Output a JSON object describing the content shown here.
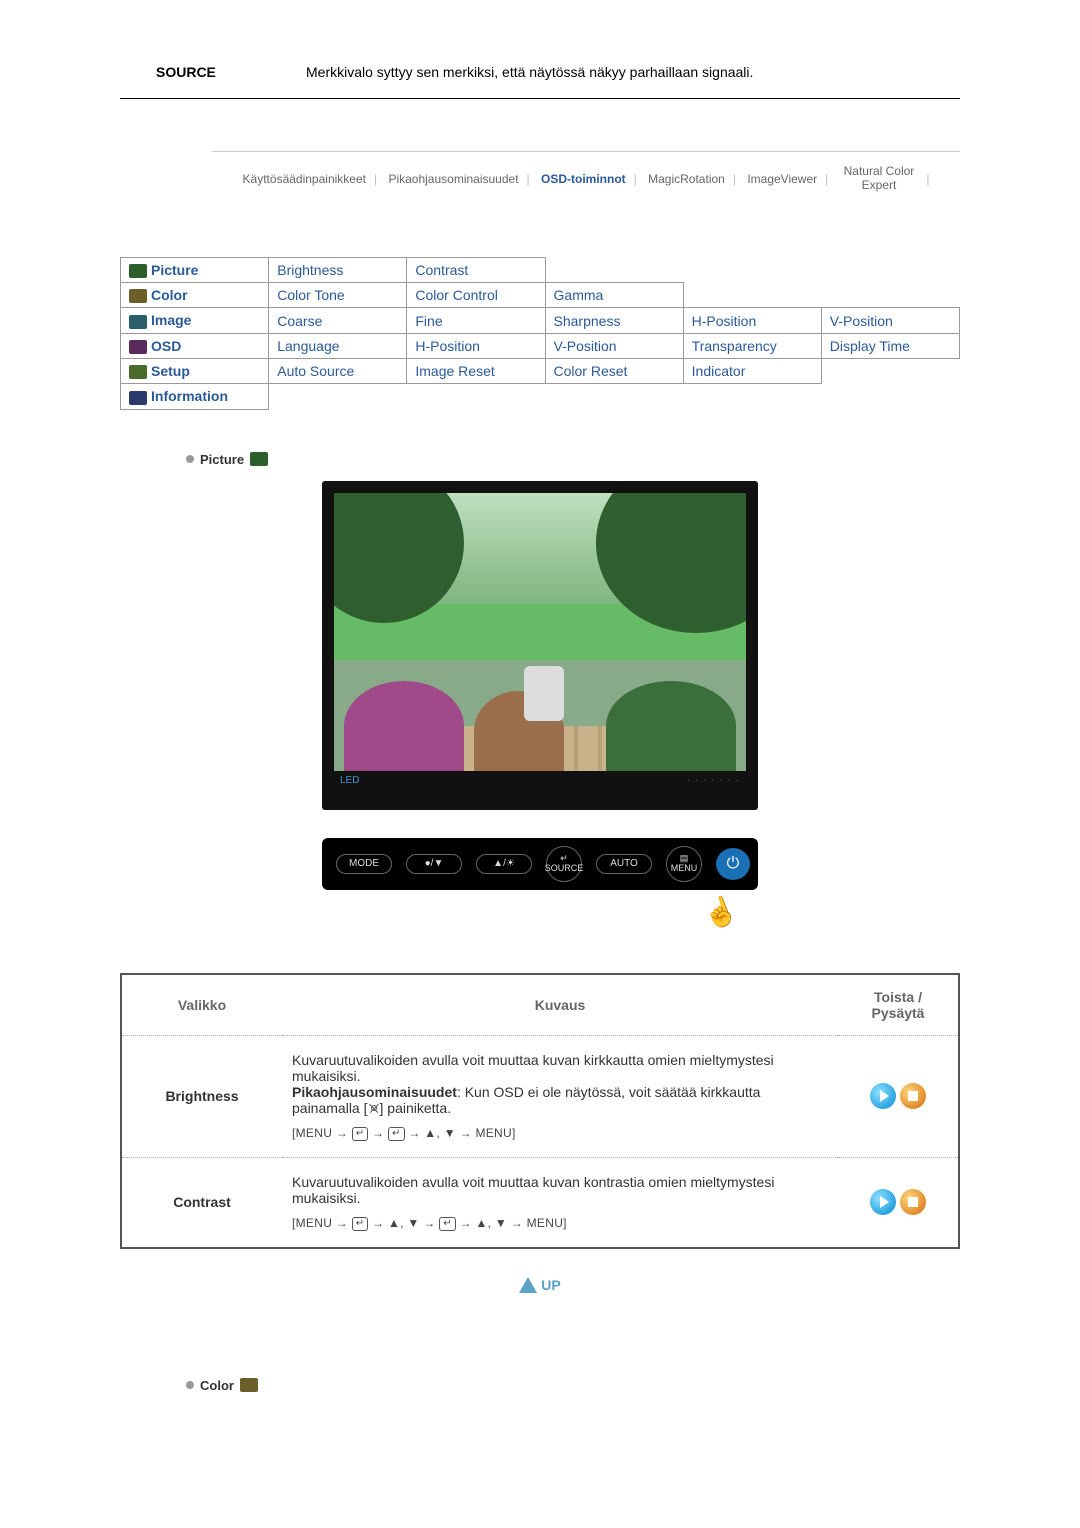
{
  "source_row": {
    "label": "SOURCE",
    "text": "Merkkivalo syttyy sen merkiksi, että näytössä näkyy parhaillaan signaali."
  },
  "tabs": {
    "t0": "Käyttösäädinpainikkeet",
    "t1": "Pikaohjausominaisuudet",
    "t2": "OSD-toiminnot",
    "t3": "MagicRotation",
    "t4": "ImageViewer",
    "t5a": "Natural Color",
    "t5b": "Expert"
  },
  "menu": {
    "picture": "Picture",
    "brightness": "Brightness",
    "contrast": "Contrast",
    "color": "Color",
    "colortone": "Color Tone",
    "colorcontrol": "Color Control",
    "gamma": "Gamma",
    "image": "Image",
    "coarse": "Coarse",
    "fine": "Fine",
    "sharpness": "Sharpness",
    "hpos": "H-Position",
    "vpos": "V-Position",
    "osd": "OSD",
    "language": "Language",
    "transparency": "Transparency",
    "displaytime": "Display Time",
    "setup": "Setup",
    "autosource": "Auto Source",
    "imagereset": "Image Reset",
    "colorreset": "Color Reset",
    "indicator": "Indicator",
    "information": "Information"
  },
  "section": {
    "picture_title": "Picture",
    "color_title": "Color"
  },
  "monitor": {
    "led": "LED",
    "buttons": {
      "mode": "MODE",
      "downup": "●/▼",
      "bright": "▲/☀",
      "source_top": "↵",
      "source": "SOURCE",
      "auto": "AUTO",
      "menu_top": "▤",
      "menu": "MENU",
      "power": "⏻"
    }
  },
  "desc_table": {
    "head_menu": "Valikko",
    "head_kuvaus": "Kuvaus",
    "head_play": "Toista / Pysäytä",
    "rows": [
      {
        "name": "Brightness",
        "text1": "Kuvaruutuvalikoiden avulla voit muuttaa kuvan kirkkautta omien mieltymystesi mukaisiksi.",
        "bold": "Pikaohjausominaisuudet",
        "text2": ": Kun OSD ei ole näytössä, voit säätää kirkkautta painamalla [",
        "text3": "] painiketta.",
        "steps_prefix": "[MENU → ",
        "steps_mid": " → ",
        "steps_arrows": " → ▲, ▼ → MENU]"
      },
      {
        "name": "Contrast",
        "text1": "Kuvaruutuvalikoiden avulla voit muuttaa kuvan kontrastia omien mieltymystesi mukaisiksi.",
        "steps_prefix": "[MENU → ",
        "steps_mid1": " → ▲, ▼ → ",
        "steps_arrows": " → ▲, ▼ → MENU]"
      }
    ]
  },
  "up_label": "UP"
}
